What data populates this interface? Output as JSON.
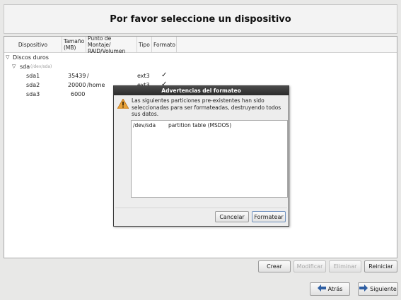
{
  "header": {
    "title": "Por favor seleccione un dispositivo"
  },
  "columns": {
    "device": "Dispositivo",
    "size_line1": "Tamaño",
    "size_line2": "(MB)",
    "mount_line1": "Punto de Montaje/",
    "mount_line2": "RAID/Volumen",
    "type": "Tipo",
    "format": "Formato"
  },
  "tree": {
    "group_label": "Discos duros",
    "disk": {
      "name": "sda",
      "path": "(/dev/sda)"
    },
    "partitions": [
      {
        "name": "sda1",
        "size": "35439",
        "mount": "/",
        "type": "ext3",
        "format": "✓"
      },
      {
        "name": "sda2",
        "size": "20000",
        "mount": "/home",
        "type": "ext3",
        "format": "✓"
      },
      {
        "name": "sda3",
        "size": "6000",
        "mount": "",
        "type": "",
        "format": ""
      }
    ]
  },
  "toolbar": {
    "create": "Crear",
    "modify": "Modificar",
    "delete": "Eliminar",
    "reset": "Reiniciar"
  },
  "navigation": {
    "back": "Atrás",
    "next": "Siguiente",
    "back_icon": "arrow-left-icon",
    "next_icon": "arrow-right-icon"
  },
  "dialog": {
    "title": "Advertencias del formateo",
    "icon": "warning-icon",
    "message": "Las siguientes particiones pre-existentes han sido seleccionadas para ser formateadas, destruyendo todos sus datos.",
    "items": [
      {
        "device": "/dev/sda",
        "description": "partition table (MSDOS)"
      }
    ],
    "cancel": "Cancelar",
    "format": "Formatear"
  },
  "colors": {
    "dialog_title_bg": "#2b2b2b",
    "warning": "#e8a33a",
    "nav_arrow": "#2f5fa3"
  }
}
